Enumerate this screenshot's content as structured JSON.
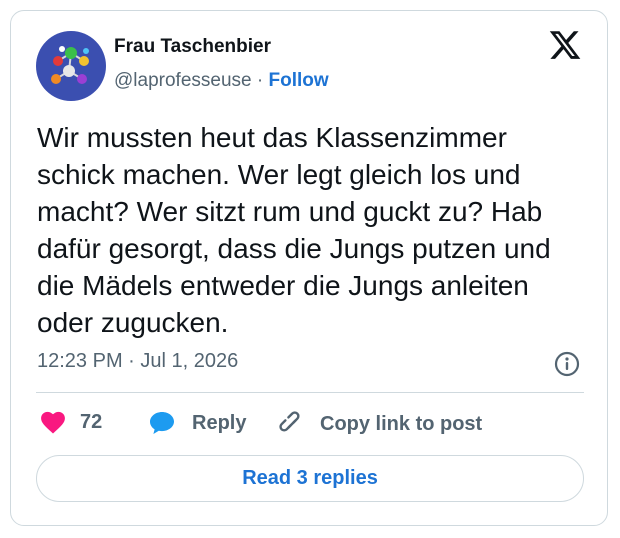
{
  "user": {
    "display_name": "Frau Taschenbier",
    "handle": "@laprofesseuse",
    "separator": " · ",
    "follow_label": "Follow"
  },
  "tweet": {
    "text": "Wir mussten heut das Klassenzimmer schick machen. Wer legt gleich los und macht? Wer sitzt rum und guckt zu? Hab dafür gesorgt, dass die Jungs putzen und die Mädels entweder die Jungs anleiten oder zugucken.",
    "timestamp": "12:23 PM · Jul 1, 2026"
  },
  "actions": {
    "like_count": "72",
    "reply_label": "Reply",
    "copy_label": "Copy link to post"
  },
  "read_replies_label": "Read 3 replies",
  "icons": {
    "platform": "x-logo-icon",
    "info": "info-icon",
    "like": "heart-icon",
    "reply": "speech-bubble-icon",
    "copy": "link-icon"
  },
  "colors": {
    "accent": "#1d73d4",
    "like": "#f91880",
    "reply": "#1d9bf0",
    "muted": "#536471"
  }
}
